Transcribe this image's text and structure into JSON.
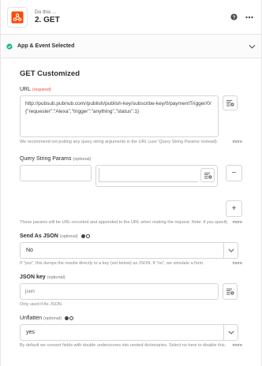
{
  "header": {
    "step_subtitle": "Do this ...",
    "step_title": "2. GET",
    "app_icon": "webhook-icon",
    "colors": {
      "accent": "#ff4a00"
    }
  },
  "section": {
    "label": "App & Event Selected",
    "status_color": "#13b988"
  },
  "main": {
    "title": "GET Customized",
    "url": {
      "label": "URL",
      "tag": "(required)",
      "value": "http://pubsub.pubnub.com//publish/publish-key/subscribe-key/0/paymentTrigger/0/{\"requester\":\"Alexa\",\"trigger\":\"anything\",\"status\":1}",
      "help": "We recommend not putting any query string arguments in the URL (use 'Query String Params' instead).",
      "more": "more"
    },
    "query_params": {
      "label": "Query String Params",
      "tag": "(optional)",
      "key_value": "",
      "value_value": "",
      "help": "These params will be URL-encoded and appended to the URL when making the request. Note: if you specify a URL with query params",
      "more": "more",
      "remove_symbol": "−",
      "add_symbol": "+"
    },
    "send_as_json": {
      "label": "Send As JSON",
      "tag": "(optional)",
      "value": "No",
      "help": "If \"yes\", this dumps the results directly to a key (set below) as JSON. If \"no\", we simulate a form.",
      "more": "more"
    },
    "json_key": {
      "label": "JSON key",
      "tag": "(optional)",
      "value": "json",
      "help": "Only used if As JSON."
    },
    "unflatten": {
      "label": "Unflatten",
      "tag": "(optional)",
      "value": "yes",
      "help": "By default we convert fields with double underscores into nested dictionaries. Select no here to disable this.",
      "more": "more"
    }
  }
}
